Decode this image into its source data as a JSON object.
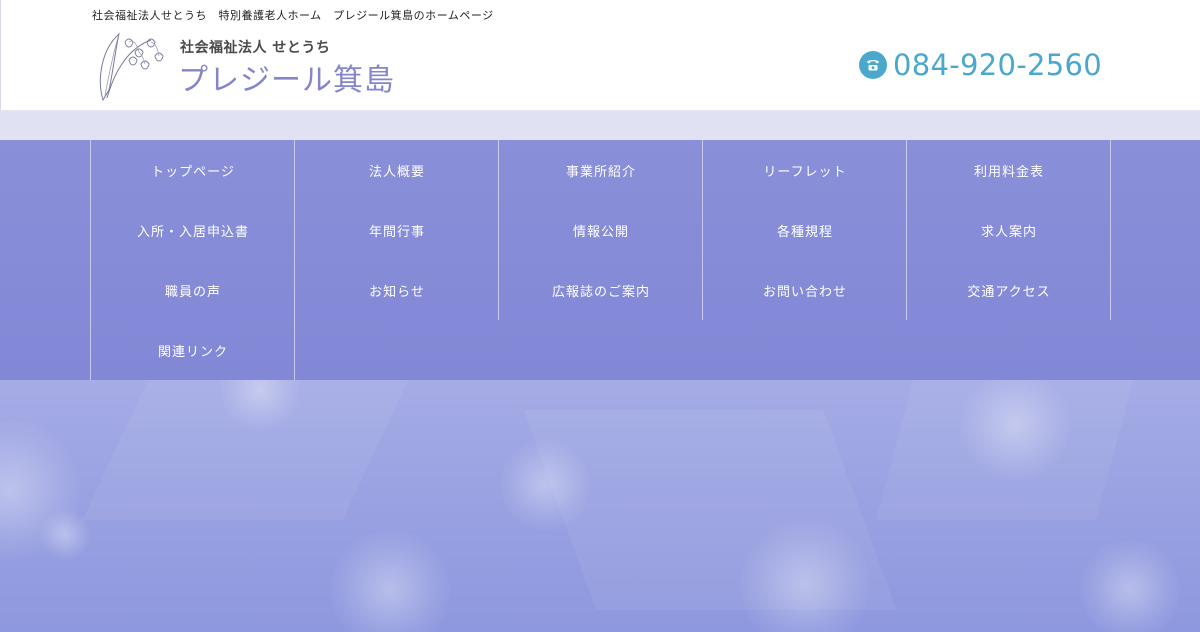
{
  "header": {
    "tagline": "社会福祉法人せとうち　特別養護老人ホーム　プレジール箕島のホームページ",
    "logo_sub": "社会福祉法人 せとうち",
    "logo_name": "プレジール箕島",
    "logo_icon": "lily-of-the-valley-logo",
    "phone_icon": "phone-icon",
    "phone_number": "084-920-2560"
  },
  "nav": {
    "items": [
      "トップページ",
      "法人概要",
      "事業所紹介",
      "リーフレット",
      "利用料金表",
      "入所・入居申込書",
      "年間行事",
      "情報公開",
      "各種規程",
      "求人案内",
      "職員の声",
      "お知らせ",
      "広報誌のご案内",
      "お問い合わせ",
      "交通アクセス",
      "関連リンク"
    ]
  },
  "colors": {
    "nav_bg": "#8a8fd9",
    "band_bg": "#e0e2f4",
    "phone": "#4aa8cc",
    "logo_text": "#8585cc"
  }
}
